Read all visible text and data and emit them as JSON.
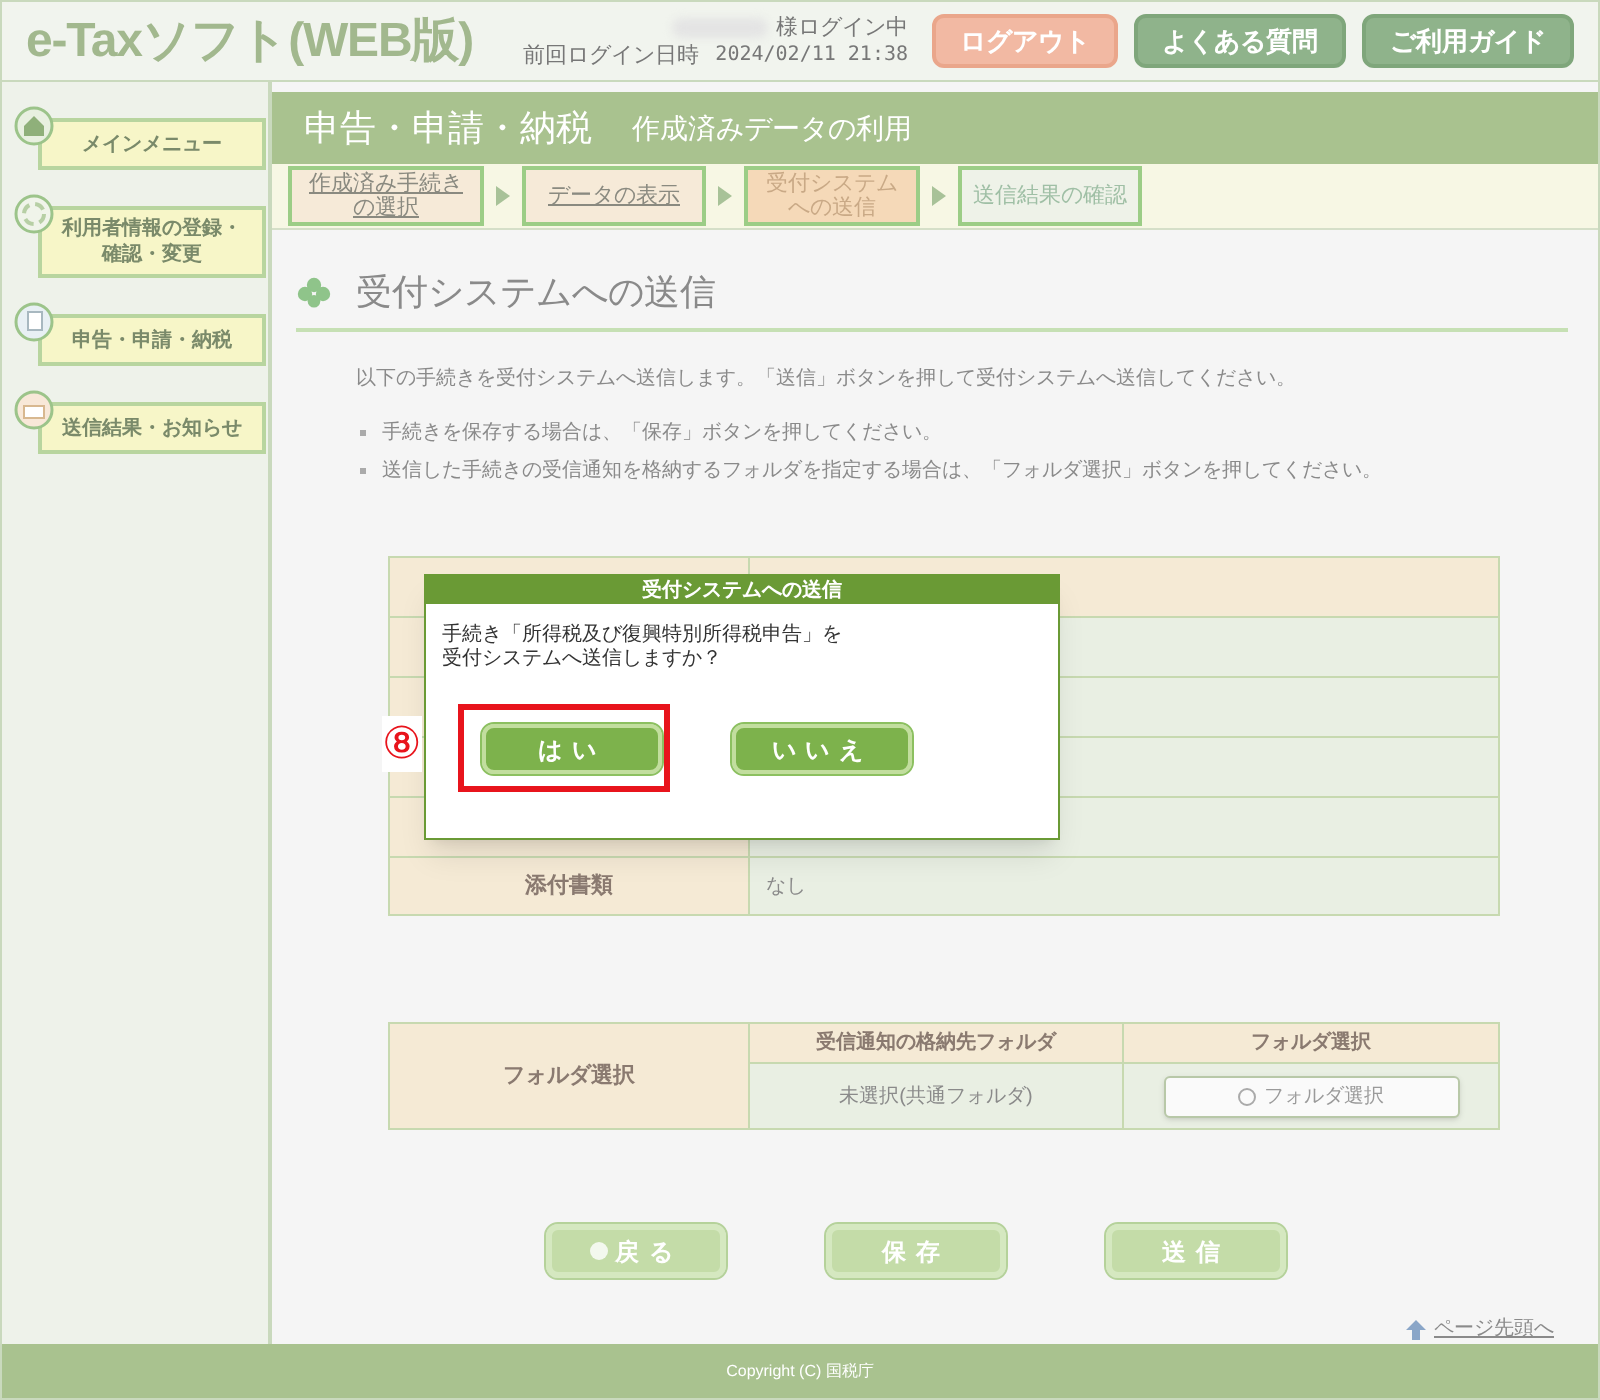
{
  "header": {
    "logo": "e-Taxソフト(WEB版)",
    "login_status": "様ログイン中",
    "last_login_label": "前回ログイン日時",
    "last_login_value": "2024/02/11 21:38",
    "buttons": [
      {
        "label": "ログアウト",
        "kind": "logout"
      },
      {
        "label": "よくある質問",
        "kind": "nav"
      },
      {
        "label": "ご利用ガイド",
        "kind": "nav"
      }
    ]
  },
  "sidebar": {
    "items": [
      {
        "label": "メインメニュー",
        "kind": "home"
      },
      {
        "label": "利用者情報の登録・確認・変更",
        "kind": "user"
      },
      {
        "label": "申告・申請・納税",
        "kind": "document"
      },
      {
        "label": "送信結果・お知らせ",
        "kind": "mail"
      }
    ]
  },
  "title_bar": {
    "title": "申告・申請・納税",
    "subtitle": "作成済みデータの利用"
  },
  "steps": [
    {
      "label": "作成済み手続きの選択",
      "kind": "link"
    },
    {
      "label": "データの表示",
      "kind": "link"
    },
    {
      "label": "受付システムへの送信",
      "kind": "current"
    },
    {
      "label": "送信結果の確認",
      "kind": "pending"
    }
  ],
  "section": {
    "heading": "受付システムへの送信",
    "intro": "以下の手続きを受付システムへ送信します。「送信」ボタンを押して受付システムへ送信してください。",
    "bullets": [
      "手続きを保存する場合は、「保存」ボタンを押してください。",
      "送信した手続きの受信通知を格納するフォルダを指定する場合は、「フォルダ選択」ボタンを押してください。"
    ]
  },
  "table": {
    "rows": [
      {
        "item": "添付書類",
        "value": "なし"
      }
    ]
  },
  "folder_table": {
    "label": "フォルダ選択",
    "columns": [
      "受信通知の格納先フォルダ",
      "フォルダ選択"
    ],
    "value": "未選択(共通フォルダ)",
    "button": "フォルダ選択"
  },
  "actions": [
    {
      "label": "戻る",
      "kind": "back"
    },
    {
      "label": "保存",
      "kind": "plain"
    },
    {
      "label": "送信",
      "kind": "plain"
    }
  ],
  "page_top_link": "ページ先頭へ",
  "footer": "Copyright (C) 国税庁",
  "dialog": {
    "title": "受付システムへの送信",
    "message_lines": [
      "手続き「所得税及び復興特別所得税申告」を",
      "受付システムへ送信しますか？"
    ],
    "buttons": [
      {
        "label": "はい",
        "highlighted": true
      },
      {
        "label": "いいえ",
        "highlighted": false
      }
    ],
    "annotation": "⑧"
  }
}
